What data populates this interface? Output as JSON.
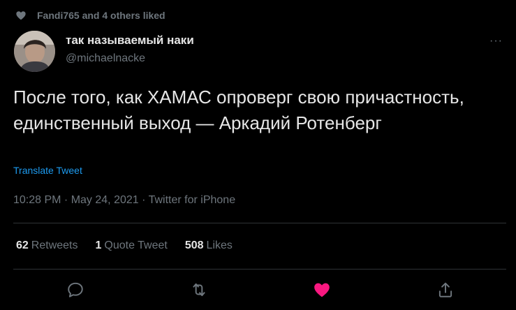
{
  "social_context": {
    "text": "Fandi765 and 4 others liked"
  },
  "author": {
    "display_name": "так называемый наки",
    "handle": "@michaelnacke"
  },
  "more_menu": {
    "glyph": "···"
  },
  "tweet": {
    "text": "После того, как ХАМАС опроверг свою причастность, единственный выход — Аркадий Ротенберг",
    "translate_label": "Translate Tweet",
    "meta": "10:28 PM · May 24, 2021 · Twitter for iPhone"
  },
  "stats": {
    "retweets": {
      "count": "62",
      "label": "Retweets"
    },
    "quote_tweets": {
      "count": "1",
      "label": "Quote Tweet"
    },
    "likes": {
      "count": "508",
      "label": "Likes"
    }
  },
  "actions": {
    "reply": {
      "icon": "reply-icon"
    },
    "retweet": {
      "icon": "retweet-icon"
    },
    "like": {
      "icon": "heart-icon",
      "active": true,
      "color": "#f91880"
    },
    "share": {
      "icon": "share-icon"
    }
  },
  "colors": {
    "background": "#000000",
    "accent": "#1d9bf0",
    "like": "#f91880",
    "muted": "#6e767d"
  }
}
